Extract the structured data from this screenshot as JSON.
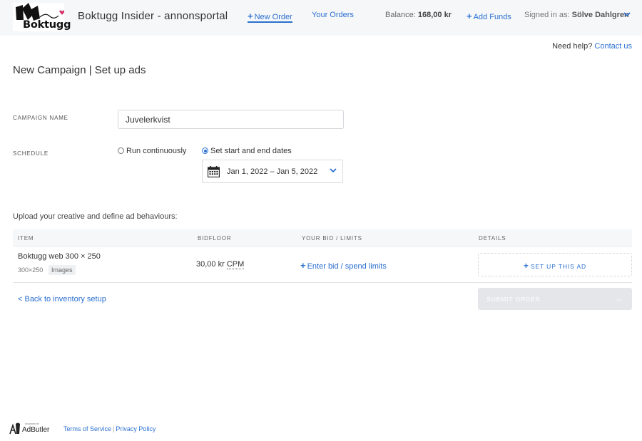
{
  "header": {
    "logo_text": "Boktugg",
    "app_title": "Boktugg Insider - annonsportal",
    "nav": {
      "new_order": "New Order",
      "your_orders": "Your Orders"
    },
    "balance_label": "Balance:",
    "balance_value": "168,00 kr",
    "add_funds": "Add Funds",
    "signed_in_label": "Signed in as:",
    "user_name": "Sölve Dahlgren"
  },
  "help": {
    "text": "Need help?",
    "link": "Contact us"
  },
  "page_title": "New Campaign | Set up ads",
  "form": {
    "campaign_name_label": "CAMPAIGN NAME",
    "campaign_name_value": "Juvelerkvist",
    "schedule_label": "SCHEDULE",
    "schedule_options": {
      "continuous": "Run continuously",
      "dates": "Set start and end dates"
    },
    "date_range": "Jan 1, 2022 – Jan 5, 2022"
  },
  "upload_text": "Upload your creative and define ad behaviours:",
  "table": {
    "headers": {
      "item": "ITEM",
      "bidfloor": "BIDFLOOR",
      "bid": "YOUR BID / LIMITS",
      "details": "DETAILS"
    },
    "row": {
      "name": "Boktugg web 300 × 250",
      "size": "300×250",
      "tag": "Images",
      "bidfloor_amount": "30,00 kr",
      "bidfloor_unit": "CPM",
      "enter_bid": "Enter bid / spend limits",
      "setup_ad": "SET UP THIS AD"
    }
  },
  "actions": {
    "back": "< Back to inventory setup",
    "submit": "SUBMIT ORDER"
  },
  "footer": {
    "powered_small": "POWERED BY",
    "brand": "AdButler",
    "terms": "Terms of Service",
    "privacy": "Privacy Policy"
  },
  "colors": {
    "accent": "#2a6fd0",
    "header_bg": "#f6f7f9",
    "logo_pink": "#d6336c"
  }
}
